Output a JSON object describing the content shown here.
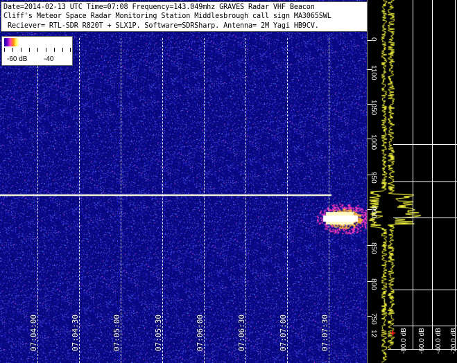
{
  "header": {
    "line1": "Date=2014-02-13 UTC Time=07:08 Frequency=143.049mhz GRAVES Radar VHF Beacon",
    "line2": "Cliff's Meteor Space Radar Monitoring Station Middlesbrough call sign MA3065SWL",
    "line3": " Reciever= RTL-SDR R820T + SLX1P. Software=SDRSharp. Antenna= 2M Yagi HB9CV."
  },
  "legend": {
    "left_label": "-60 dB",
    "right_label": "-40"
  },
  "time_axis": {
    "labels": [
      "07:04:00",
      "07:04:30",
      "07:05:00",
      "07:05:30",
      "07:06:00",
      "07:06:30",
      "07:07:00",
      "07:07:30"
    ]
  },
  "freq_axis": {
    "labels": [
      "0",
      "1100",
      "1050",
      "1000",
      "950",
      "900",
      "850",
      "800",
      "750",
      "12"
    ]
  },
  "spectrum": {
    "db_labels": [
      "-80.0 dB",
      "-60.0 dB",
      "-40.0 dB",
      "-20.0 dB"
    ],
    "cursor_symbol": "+"
  },
  "colors": {
    "waterfall_bg": "#06066a",
    "noise": "#5a5aff",
    "carrier": "#ffffc0",
    "spectrum_trace": "#ffff40",
    "cursor": "#ff2020"
  }
}
